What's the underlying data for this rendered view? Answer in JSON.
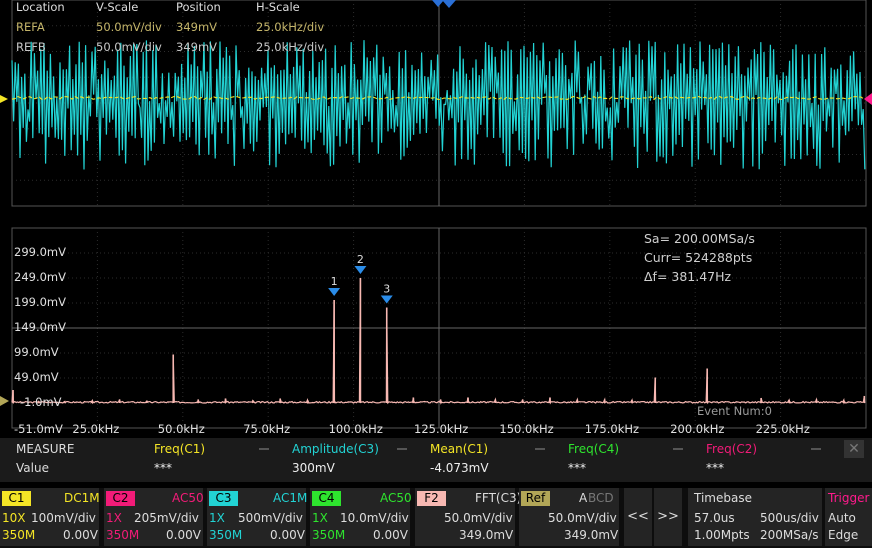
{
  "colors": {
    "c1": "#f4e526",
    "c2": "#f21b78",
    "c3": "#22d3d4",
    "c4": "#2ee42e",
    "f2": "#f7b8b2",
    "ref": "#b2a657",
    "trigger": "#ff1a8c"
  },
  "reference_table": {
    "headers": [
      "Location",
      "V-Scale",
      "Position",
      "H-Scale"
    ],
    "rows": [
      {
        "name": "REFA",
        "vscale": "50.0mV/div",
        "position": "349mV",
        "hscale": "25.0kHz/div"
      },
      {
        "name": "REFB",
        "vscale": "50.0mV/div",
        "position": "349mV",
        "hscale": "25.0kHz/div"
      }
    ]
  },
  "fft_info": {
    "sa": "Sa=  200.00MSa/s",
    "curr": "Curr= 524288pts",
    "df": "Δf=  381.47Hz"
  },
  "event_num": "Event Num:0",
  "chart_data": {
    "type": "line",
    "title": "",
    "xlabel": "",
    "ylabel": "",
    "x_unit": "kHz",
    "y_unit": "mV",
    "xlim": [
      0,
      250
    ],
    "ylim": [
      -51,
      349
    ],
    "y_tick_labels": [
      "299.0mV",
      "249.0mV",
      "199.0mV",
      "149.0mV",
      "99.0mV",
      "49.0mV",
      "-1.0mV",
      "-51.0mV"
    ],
    "x_tick_labels": [
      "25.0kHz",
      "50.0kHz",
      "75.0kHz",
      "100.0kHz",
      "125.0kHz",
      "150.0kHz",
      "175.0kHz",
      "200.0kHz",
      "225.0kHz"
    ],
    "series": [
      {
        "peaks": [
          {
            "x": 0.3,
            "y": 25
          },
          {
            "x": 7.8,
            "y": 2
          },
          {
            "x": 15.5,
            "y": 2
          },
          {
            "x": 23.5,
            "y": 4
          },
          {
            "x": 31.5,
            "y": 6
          },
          {
            "x": 39.5,
            "y": 3
          },
          {
            "x": 47.2,
            "y": 96
          },
          {
            "x": 54.5,
            "y": 6
          },
          {
            "x": 62.5,
            "y": 8
          },
          {
            "x": 70.5,
            "y": 4
          },
          {
            "x": 78.5,
            "y": 8
          },
          {
            "x": 86.5,
            "y": 5
          },
          {
            "x": 94.3,
            "y": 205
          },
          {
            "x": 109.7,
            "y": 190
          },
          {
            "x": 117.5,
            "y": 10
          },
          {
            "x": 125.5,
            "y": 6
          },
          {
            "x": 133.5,
            "y": 10
          },
          {
            "x": 141.5,
            "y": 6
          },
          {
            "x": 149.5,
            "y": 6
          },
          {
            "x": 157.5,
            "y": 10
          },
          {
            "x": 165.5,
            "y": 6
          },
          {
            "x": 173.5,
            "y": 6
          },
          {
            "x": 181.5,
            "y": 5
          },
          {
            "x": 188.3,
            "y": 50
          },
          {
            "x": 203.5,
            "y": 68
          },
          {
            "x": 219.3,
            "y": 9
          },
          {
            "x": 227.5,
            "y": 5
          },
          {
            "x": 235.5,
            "y": 6
          },
          {
            "x": 243.5,
            "y": 5
          },
          {
            "x": 249.5,
            "y": 13
          }
        ],
        "main_peak": {
          "x": 102.0,
          "y": 249
        }
      }
    ],
    "markers": [
      {
        "label": "1",
        "x": 94.3
      },
      {
        "label": "2",
        "x": 102.0
      },
      {
        "label": "3",
        "x": 109.7
      }
    ]
  },
  "measure": {
    "title": "MEASURE",
    "value_label": "Value",
    "items": [
      {
        "label": "Freq(C1)",
        "value": "***",
        "color": "#f4e526"
      },
      {
        "label": "Amplitude(C3)",
        "value": "300mV",
        "color": "#22d3d4"
      },
      {
        "label": "Mean(C1)",
        "value": "-4.073mV",
        "color": "#f4e526"
      },
      {
        "label": "Freq(C4)",
        "value": "***",
        "color": "#2ee42e"
      },
      {
        "label": "Freq(C2)",
        "value": "***",
        "color": "#f21b78"
      }
    ],
    "close_icon": "✕"
  },
  "channels": [
    {
      "tag": "C1",
      "coupling": "DC1M",
      "probe": "10X",
      "scale": "100mV/div",
      "bw": "350M",
      "offset": "0.00V"
    },
    {
      "tag": "C2",
      "coupling": "AC50",
      "probe": "1X",
      "scale": "205mV/div",
      "bw": "350M",
      "offset": "0.00V"
    },
    {
      "tag": "C3",
      "coupling": "AC1M",
      "probe": "1X",
      "scale": "500mV/div",
      "bw": "350M",
      "offset": "0.00V"
    },
    {
      "tag": "C4",
      "coupling": "AC50",
      "probe": "1X",
      "scale": "10.0mV/div",
      "bw": "350M",
      "offset": "0.00V"
    }
  ],
  "f2": {
    "tag": "F2",
    "source": "FFT(C3)",
    "scale": "50.0mV/div",
    "offset": "349.0mV"
  },
  "ref": {
    "tag": "Ref",
    "letters_a": "A",
    "letters_bcd": "BCD",
    "scale": "50.0mV/div",
    "offset": "349.0mV"
  },
  "nav": {
    "prev": "<<",
    "next": ">>"
  },
  "timebase": {
    "title": "Timebase",
    "delay": "57.0us",
    "scale": "500us/div",
    "points": "1.00Mpts",
    "rate": "200MSa/s"
  },
  "trigger": {
    "title": "Trigger",
    "mode": "Auto",
    "type": "Edge"
  }
}
